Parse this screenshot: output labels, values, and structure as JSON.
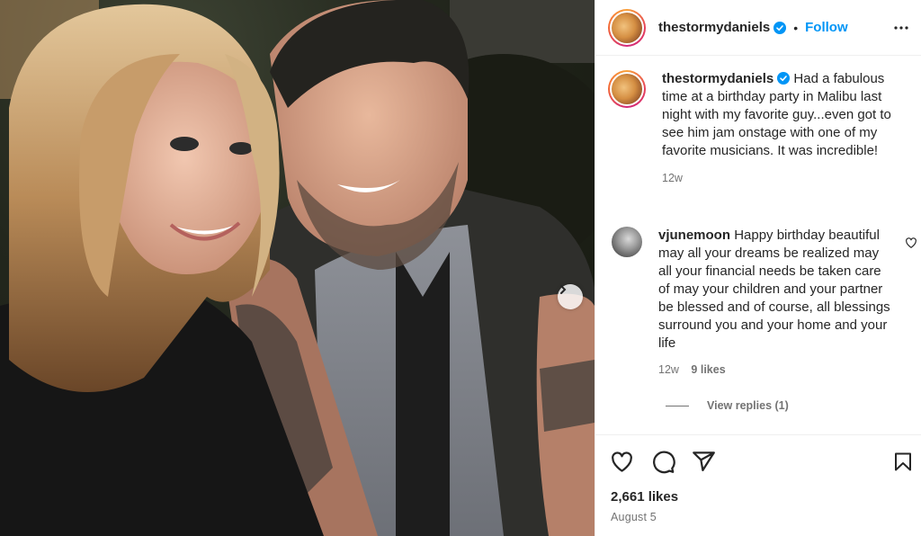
{
  "post": {
    "author": "thestormydaniels",
    "follow_label": "Follow",
    "separator": "•",
    "caption": "Had a fabulous time at a birthday party in Malibu last night with my favorite guy...even got to see him jam onstage with one of my favorite musicians. It was incredible!",
    "caption_age": "12w"
  },
  "comments": [
    {
      "username": "vjunemoon",
      "text": "Happy birthday beautiful may all your dreams be realized may all your financial needs be taken care of may your children and your partner be blessed and of course, all blessings surround you and your home and your life",
      "age": "12w",
      "likes": "9 likes",
      "view_replies": "View replies (1)"
    }
  ],
  "stats": {
    "likes": "2,661 likes",
    "date": "August 5"
  },
  "icons": {
    "verified": "verified-badge-icon",
    "more": "more-horizontal-icon",
    "like": "heart-icon",
    "comment": "comment-icon",
    "share": "share-icon",
    "save": "bookmark-icon",
    "next": "chevron-right-icon"
  },
  "colors": {
    "accent": "#0095f6",
    "text": "#262626",
    "muted": "#737373"
  }
}
